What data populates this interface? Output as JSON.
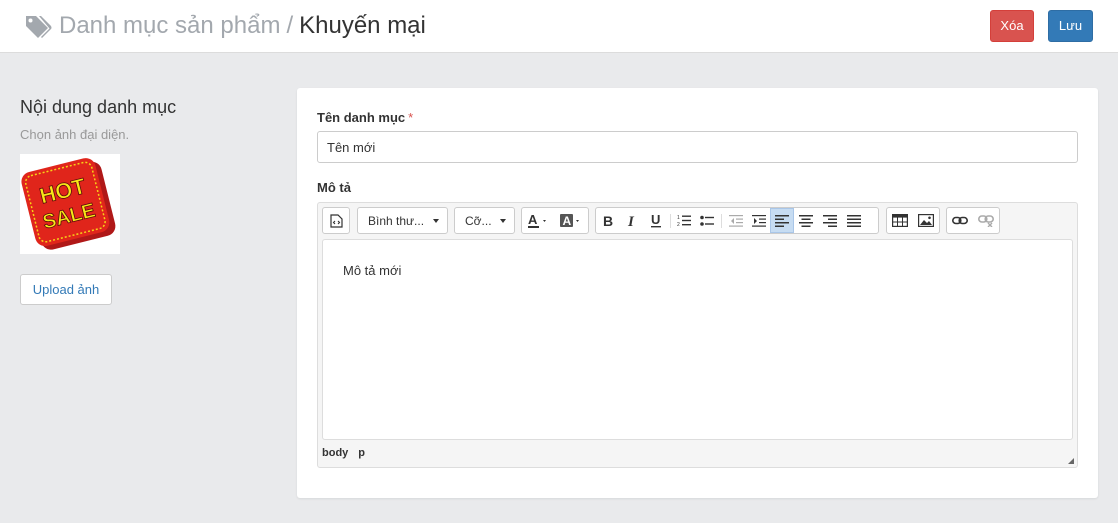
{
  "header": {
    "icon": "tag-icon",
    "breadcrumb_parent": "Danh mục sản phẩm",
    "breadcrumb_separator": "/",
    "breadcrumb_current": "Khuyến mại",
    "delete_label": "Xóa",
    "save_label": "Lưu",
    "delete_color": "#d9534f",
    "save_color": "#337ab7"
  },
  "left": {
    "title": "Nội dung danh mục",
    "hint": "Chọn ảnh đại diện.",
    "image_text_line1": "HOT",
    "image_text_line2": "SALE",
    "upload_label": "Upload ảnh"
  },
  "form": {
    "name_label": "Tên danh mục",
    "required_mark": "*",
    "name_value": "Tên mới",
    "desc_label": "Mô tả"
  },
  "editor": {
    "style_dropdown": "Bình thư...",
    "size_dropdown": "Cỡ...",
    "content": "Mô tả mới",
    "path": [
      "body",
      "p"
    ],
    "active_alignment": "left"
  }
}
